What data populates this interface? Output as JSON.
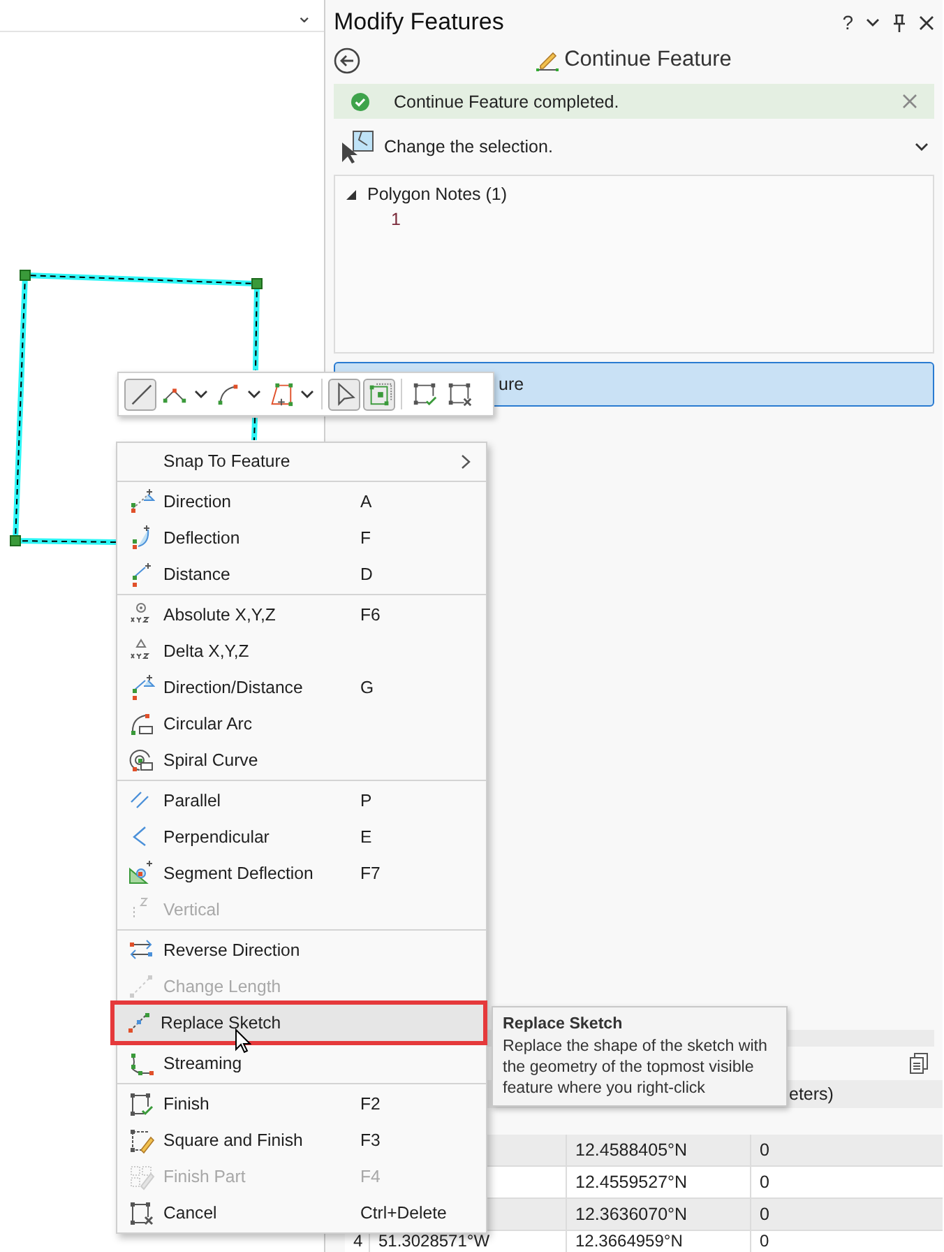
{
  "map": {
    "pane_menu": "⌄"
  },
  "panel": {
    "title": "Modify Features",
    "help": "?",
    "tool_title": "Continue Feature",
    "message": {
      "kind": "success",
      "text": "Continue Feature completed."
    },
    "step": {
      "text": "Change the selection.",
      "expanded": false
    },
    "tree": [
      {
        "label": "Polygon Notes (1)",
        "expanded": true,
        "children": [
          {
            "label": "1"
          }
        ]
      }
    ],
    "selected_feature": {
      "text": "ure",
      "selected": true
    },
    "table": {
      "header": "eters)",
      "rows": [
        {
          "column_3": "12.4588405°N",
          "column_4": "0"
        },
        {
          "column_3": "12.4559527°N",
          "column_4": "0"
        },
        {
          "column_3": "12.3636070°N",
          "column_4": "0"
        },
        {
          "column_1": "4",
          "column_2": "51.3028571°W",
          "column_3": "12.3664959°N",
          "column_4": "0"
        }
      ]
    }
  },
  "toolbar": {
    "groups": [
      [
        {
          "kind": "line",
          "selected": true,
          "dropdown": false
        },
        {
          "kind": "vertex",
          "selected": false,
          "dropdown": true
        },
        {
          "kind": "arc",
          "selected": false,
          "dropdown": true
        },
        {
          "kind": "polygon",
          "selected": false,
          "dropdown": true
        }
      ],
      [
        {
          "kind": "pointer",
          "selected": true,
          "dropdown": false
        },
        {
          "kind": "vertices",
          "selected": true,
          "dropdown": false
        }
      ],
      [
        {
          "kind": "finish",
          "selected": false,
          "dropdown": false
        },
        {
          "kind": "cancel",
          "selected": false,
          "dropdown": false
        }
      ]
    ]
  },
  "context_menu": {
    "groups": [
      [
        {
          "label": "Snap To Feature",
          "kind": "submenu",
          "disabled": false,
          "selected": false
        }
      ],
      [
        {
          "label": "Direction",
          "shortcut": "A",
          "kind": "item",
          "disabled": false,
          "selected": false
        },
        {
          "label": "Deflection",
          "shortcut": "F",
          "kind": "item",
          "disabled": false,
          "selected": false
        },
        {
          "label": "Distance",
          "shortcut": "D",
          "kind": "item",
          "disabled": false,
          "selected": false
        }
      ],
      [
        {
          "label": "Absolute X,Y,Z",
          "shortcut": "F6",
          "kind": "item",
          "disabled": false,
          "selected": false
        },
        {
          "label": "Delta X,Y,Z",
          "kind": "item",
          "disabled": false,
          "selected": false
        },
        {
          "label": "Direction/Distance",
          "shortcut": "G",
          "kind": "item",
          "disabled": false,
          "selected": false
        },
        {
          "label": "Circular Arc",
          "kind": "item",
          "disabled": false,
          "selected": false
        },
        {
          "label": "Spiral Curve",
          "kind": "item",
          "disabled": false,
          "selected": false
        }
      ],
      [
        {
          "label": "Parallel",
          "shortcut": "P",
          "kind": "item",
          "disabled": false,
          "selected": false
        },
        {
          "label": "Perpendicular",
          "shortcut": "E",
          "kind": "item",
          "disabled": false,
          "selected": false
        },
        {
          "label": "Segment Deflection",
          "shortcut": "F7",
          "kind": "item",
          "disabled": false,
          "selected": false
        },
        {
          "label": "Vertical",
          "kind": "item",
          "disabled": true,
          "selected": false
        }
      ],
      [
        {
          "label": "Reverse Direction",
          "kind": "item",
          "disabled": false,
          "selected": false
        },
        {
          "label": "Change Length",
          "kind": "item",
          "disabled": true,
          "selected": false
        },
        {
          "label": "Replace Sketch",
          "kind": "item",
          "disabled": false,
          "selected": true
        },
        {
          "label": "Streaming",
          "kind": "item",
          "disabled": false,
          "selected": false
        }
      ],
      [
        {
          "label": "Finish",
          "shortcut": "F2",
          "kind": "item",
          "disabled": false,
          "selected": false
        },
        {
          "label": "Square and Finish",
          "shortcut": "F3",
          "kind": "item",
          "disabled": false,
          "selected": false
        },
        {
          "label": "Finish Part",
          "shortcut": "F4",
          "kind": "item",
          "disabled": true,
          "selected": false
        },
        {
          "label": "Cancel",
          "shortcut": "Ctrl+Delete",
          "kind": "item",
          "disabled": false,
          "selected": false
        }
      ]
    ]
  },
  "tooltip": {
    "title": "Replace Sketch",
    "text": "Replace the shape of the sketch with the geometry of the topmost visible feature where you right-click"
  }
}
